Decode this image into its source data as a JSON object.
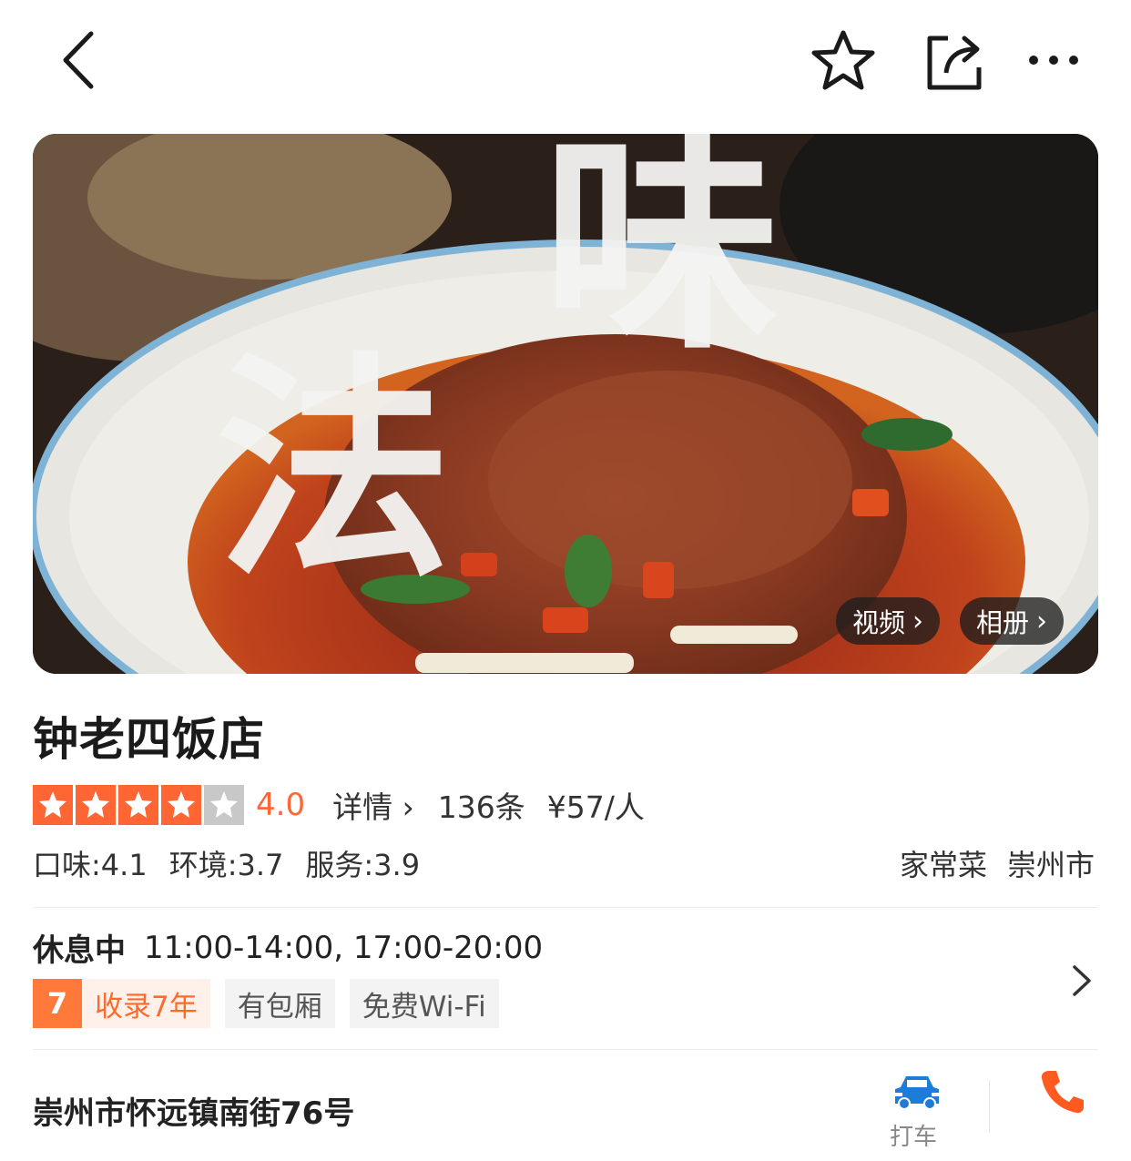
{
  "header": {
    "back_icon": "chevron-left-icon",
    "favorite_icon": "star-outline-icon",
    "share_icon": "share-icon",
    "more_icon": "more-horizontal-icon"
  },
  "hero": {
    "image": "spicy-beef-dish-photo",
    "overlay_text": [
      "味",
      "法"
    ],
    "video_label": "视频",
    "album_label": "相册"
  },
  "restaurant": {
    "name": "钟老四饭店",
    "rating": 4.0,
    "rating_text": "4.0",
    "stars_filled": 4,
    "stars_total": 5,
    "detail_label": "详情",
    "review_count": "136条",
    "price_per_person": "¥57/人",
    "scores": {
      "taste": "口味:4.1",
      "environment": "环境:3.7",
      "service": "服务:3.9"
    },
    "category": "家常菜",
    "city": "崇州市"
  },
  "business": {
    "status": "休息中",
    "hours": "11:00-14:00, 17:00-20:00",
    "years_badge": "7",
    "years_label": "收录7年",
    "tags": [
      "有包厢",
      "免费Wi-Fi"
    ]
  },
  "address": {
    "text": "崇州市怀远镇南街76号",
    "taxi_label": "打车"
  },
  "colors": {
    "accent": "#ff6633",
    "taxi_blue": "#1e7bd8",
    "phone_orange": "#ff5a1f"
  }
}
